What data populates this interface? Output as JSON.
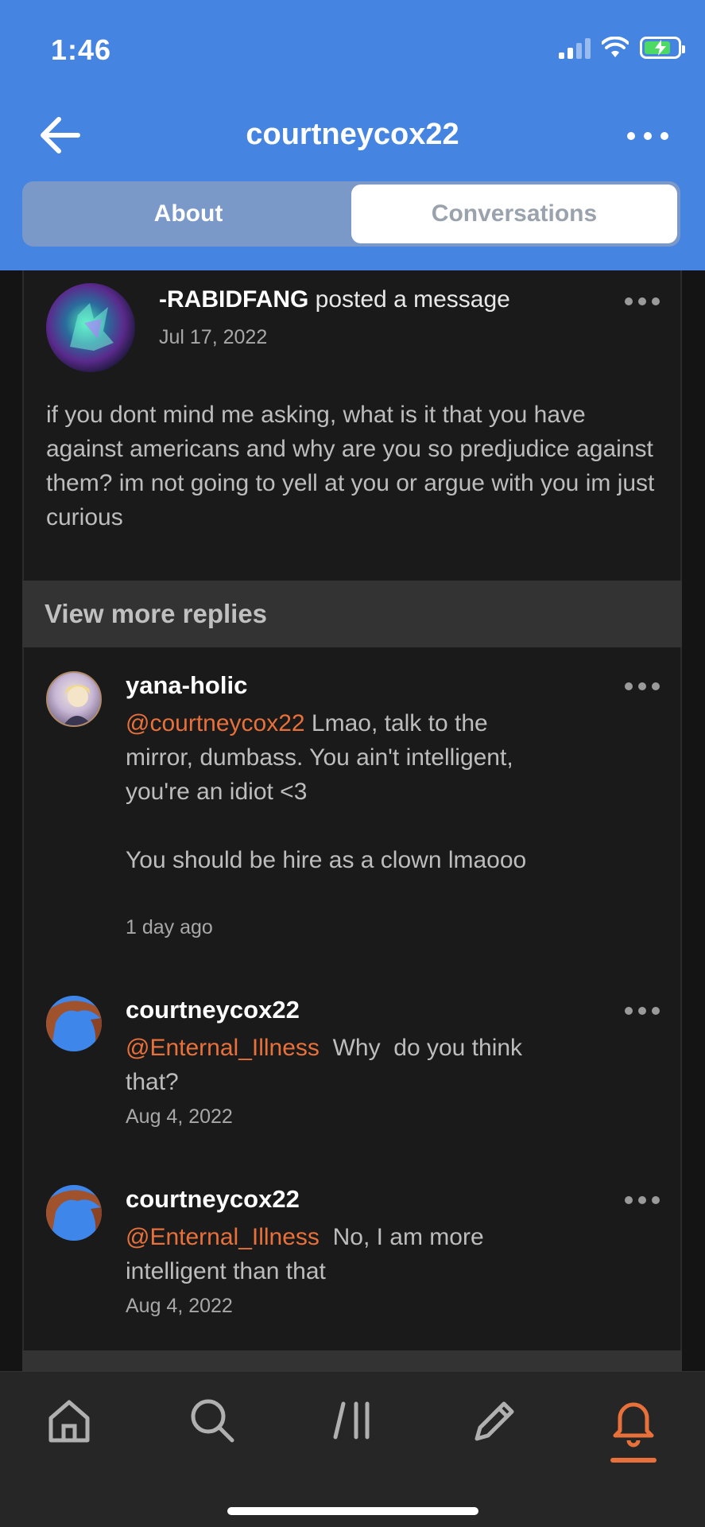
{
  "status_bar": {
    "time": "1:46"
  },
  "header": {
    "title": "courtneycox22"
  },
  "tabs": {
    "about": "About",
    "conversations": "Conversations"
  },
  "post": {
    "author": "-RABIDFANG",
    "action": " posted a message",
    "date": "Jul 17, 2022",
    "body": "if you dont mind me asking, what is it that you have against americans and why are you so predjudice against them? im not going to yell at you or argue with you im just curious"
  },
  "view_more_replies": "View more replies",
  "replies": [
    {
      "name": "yana-holic",
      "mention": "@courtneycox22",
      "text": " Lmao, talk to the mirror, dumbass. You ain't intelligent, you're an idiot <3\n\nYou should be hire as a clown lmaooo",
      "date": "1 day ago"
    },
    {
      "name": "courtneycox22",
      "mention": "@Enternal_Illness",
      "text": "  Why  do you think that?",
      "date": "Aug 4, 2022"
    },
    {
      "name": "courtneycox22",
      "mention": "@Enternal_Illness",
      "text": "  No, I am more intelligent than that",
      "date": "Aug 4, 2022"
    }
  ],
  "nav": {
    "icons": [
      "home-icon",
      "search-icon",
      "feed-icon",
      "compose-icon",
      "notifications-icon"
    ],
    "active": "notifications-icon",
    "accent": "#e8703a"
  },
  "colors": {
    "header": "#4684e1",
    "mention": "#e8703a",
    "background": "#141414"
  }
}
